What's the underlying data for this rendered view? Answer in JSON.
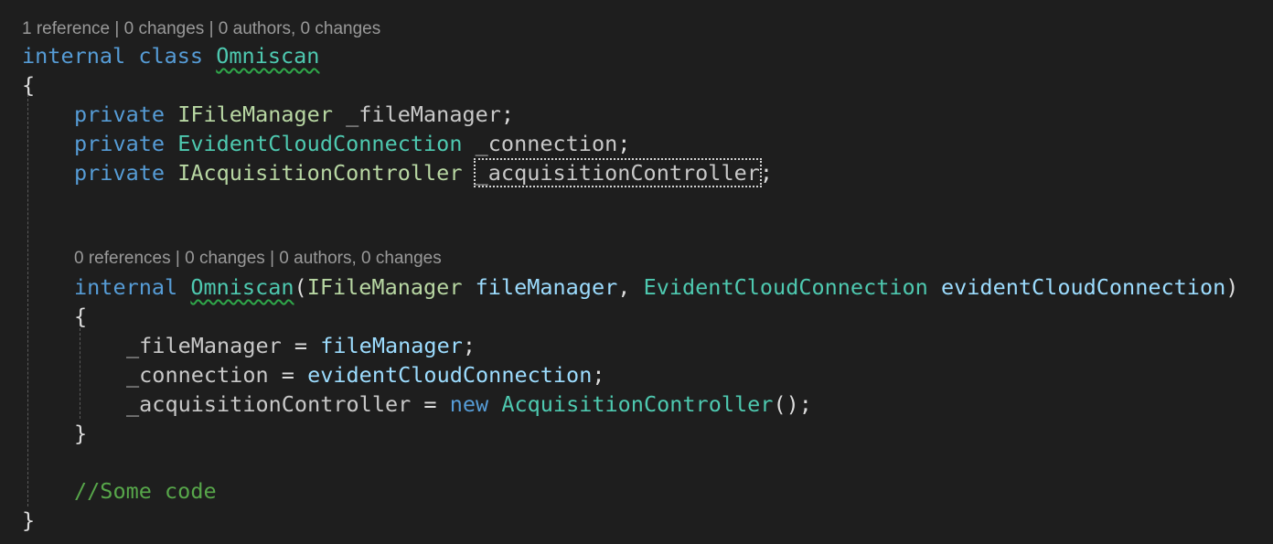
{
  "colors": {
    "background": "#1e1e1e",
    "keyword": "#569cd6",
    "interface": "#b8d7a3",
    "class": "#4ec9b0",
    "field": "#c8c8c8",
    "parameter": "#9cdcfe",
    "comment": "#57a64a",
    "punctuation": "#dcdcdc",
    "codelens": "#999999",
    "squiggle": "#2fa84a"
  },
  "codelens": {
    "class_info": "1 reference | 0 changes | 0 authors, 0 changes",
    "ctor_info": "0 references | 0 changes | 0 authors, 0 changes"
  },
  "code": {
    "class_keyword_internal": "internal",
    "class_keyword_class": "class",
    "class_name": "Omniscan",
    "open_brace": "{",
    "close_brace": "}",
    "fields": [
      {
        "modifier": "private",
        "type": "IFileManager",
        "name": "_fileManager"
      },
      {
        "modifier": "private",
        "type": "EvidentCloudConnection",
        "name": "_connection"
      },
      {
        "modifier": "private",
        "type": "IAcquisitionController",
        "name": "_acquisitionController"
      }
    ],
    "ctor": {
      "modifier": "internal",
      "name": "Omniscan",
      "param1_type": "IFileManager",
      "param1_name": "fileManager",
      "param2_type": "EvidentCloudConnection",
      "param2_name": "evidentCloudConnection",
      "body": [
        {
          "target": "_fileManager",
          "value": "fileManager"
        },
        {
          "target": "_connection",
          "value": "evidentCloudConnection"
        },
        {
          "target": "_acquisitionController",
          "new_keyword": "new",
          "class_name": "AcquisitionController",
          "call": "()"
        }
      ]
    },
    "comment": "//Some code"
  }
}
